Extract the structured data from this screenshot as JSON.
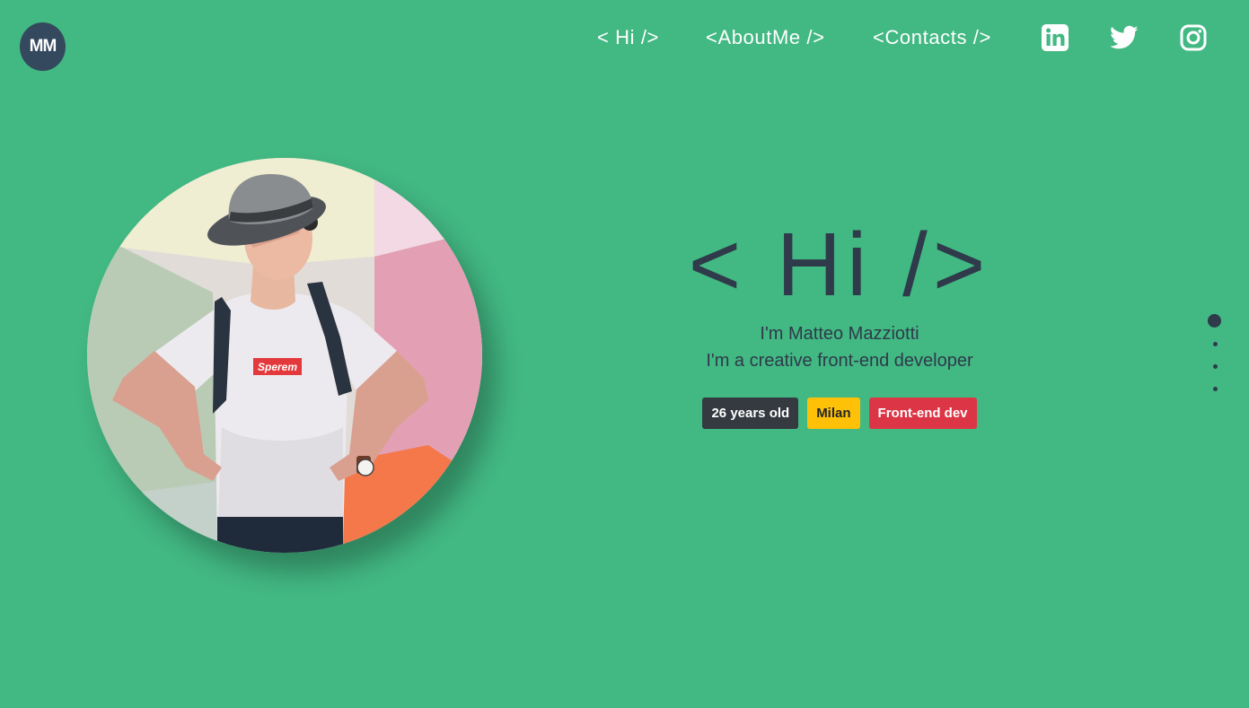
{
  "logo": {
    "text": "MM"
  },
  "nav": {
    "links": [
      {
        "label": "< Hi />"
      },
      {
        "label": "<AboutMe />"
      },
      {
        "label": "<Contacts />"
      }
    ],
    "social": [
      "linkedin-icon",
      "twitter-icon",
      "instagram-icon"
    ]
  },
  "hero": {
    "title": "< Hi />",
    "name_line": "I'm Matteo Mazziotti",
    "role_line": "I'm a creative front-end developer",
    "badges": [
      {
        "label": "26 years old",
        "color": "#343a40"
      },
      {
        "label": "Milan",
        "color": "#ffc107"
      },
      {
        "label": "Front-end dev",
        "color": "#dc3545"
      }
    ]
  },
  "portrait": {
    "shirt_text": "Sperem"
  },
  "section_dots": {
    "count": 4,
    "active_index": 0
  },
  "colors": {
    "background": "#42b883",
    "dark": "#2f3a4a",
    "logo_bg": "#34495e",
    "white": "#ffffff"
  }
}
